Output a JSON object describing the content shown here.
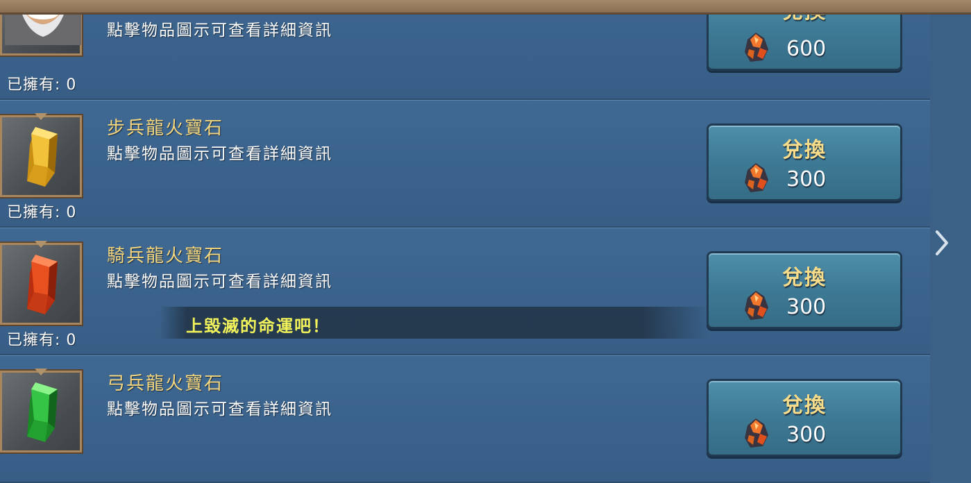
{
  "items": [
    {
      "name": "",
      "description": "點擊物品圖示可查看詳細資訊",
      "owned": "已擁有: 0",
      "button_label": "兌換",
      "price": "600",
      "icon": "hero-portrait-icon"
    },
    {
      "name": "步兵龍火寶石",
      "description": "點擊物品圖示可查看詳細資訊",
      "owned": "已擁有: 0",
      "button_label": "兌換",
      "price": "300",
      "icon": "yellow-gem-icon",
      "gem_color": "#e8b52a"
    },
    {
      "name": "騎兵龍火寶石",
      "description": "點擊物品圖示可查看詳細資訊",
      "owned": "已擁有: 0",
      "button_label": "兌換",
      "price": "300",
      "icon": "red-gem-icon",
      "gem_color": "#e24a1f"
    },
    {
      "name": "弓兵龍火寶石",
      "description": "點擊物品圖示可查看詳細資訊",
      "owned": "",
      "button_label": "兌換",
      "price": "300",
      "icon": "green-gem-icon",
      "gem_color": "#2fbd3c"
    }
  ],
  "currency_icon": "dragon-shard-icon",
  "banner_text": "上毀滅的命運吧！",
  "nav": {
    "next_icon": "chevron-right-icon"
  },
  "colors": {
    "background": "#3b6186",
    "item_name": "#f5d77f",
    "button": "#3f7b96",
    "banner_text": "#f2f25a"
  }
}
